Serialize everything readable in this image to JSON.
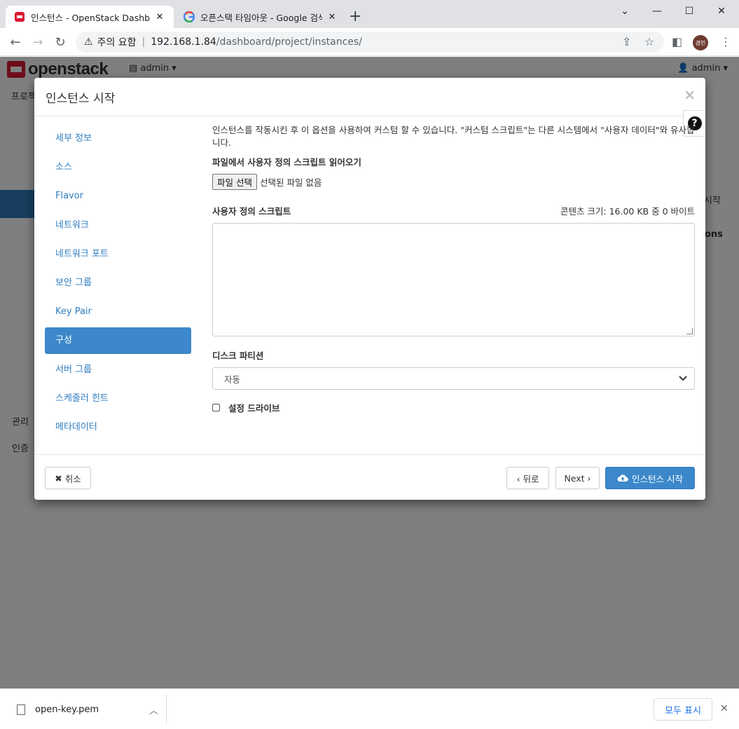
{
  "browser": {
    "tabs": [
      {
        "title": "인스턴스 - OpenStack Dashboard",
        "active": true
      },
      {
        "title": "오픈스택 타임아웃 - Google 검색",
        "active": false
      }
    ],
    "new_tab": "+",
    "window_controls": {
      "minimize": "⌄",
      "restore": "—",
      "maximize": "☐",
      "close": "✕"
    },
    "address": {
      "warning_text": "주의 요함",
      "host": "192.168.1.84",
      "path": "/dashboard/project/instances/"
    },
    "profile_initials": "경민"
  },
  "openstack": {
    "logo_text": "openstack",
    "project_menu": "admin",
    "user_menu": "admin",
    "background_texts": {
      "project_crumb": "프로젝",
      "admin": "관리",
      "identity": "인증",
      "launch": "시작",
      "actions": "ons"
    }
  },
  "modal": {
    "title": "인스턴스 시작",
    "close_label": "×",
    "help_label": "?",
    "nav": [
      {
        "label": "세부 정보",
        "active": false
      },
      {
        "label": "소스",
        "active": false
      },
      {
        "label": "Flavor",
        "active": false
      },
      {
        "label": "네트워크",
        "active": false
      },
      {
        "label": "네트워크 포트",
        "active": false
      },
      {
        "label": "보안 그룹",
        "active": false
      },
      {
        "label": "Key Pair",
        "active": false
      },
      {
        "label": "구성",
        "active": true
      },
      {
        "label": "서버 그룹",
        "active": false
      },
      {
        "label": "스케줄러 힌트",
        "active": false
      },
      {
        "label": "메타데이터",
        "active": false
      }
    ],
    "config": {
      "help_text": "인스턴스를 작동시킨 후 이 옵션을 사용하여 커스텀 할 수 있습니다. \"커스텀 스크립트\"는 다른 시스템에서 \"사용자 데이터\"와 유사합니다.",
      "file_label": "파일에서 사용자 정의 스크립트 읽어오기",
      "file_button": "파일 선택",
      "file_status": "선택된 파일 없음",
      "script_label": "사용자 정의 스크립트",
      "content_size": "콘텐츠 크기: 16.00 KB 중 0 바이트",
      "script_value": "",
      "disk_label": "디스크 파티션",
      "disk_selected": "자동",
      "config_drive_label": "설정 드라이브",
      "config_drive_checked": false
    },
    "footer": {
      "cancel": "취소",
      "back": "‹ 뒤로",
      "next": "Next ›",
      "launch": "인스턴스 시작"
    }
  },
  "downloads": {
    "file_name": "open-key.pem",
    "show_all": "모두 표시"
  }
}
